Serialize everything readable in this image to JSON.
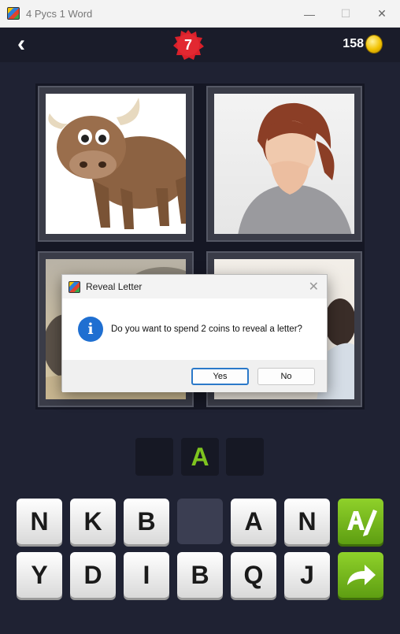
{
  "window": {
    "title": "4 Pycs 1 Word",
    "minimize_glyph": "—",
    "maximize_glyph": "☐",
    "close_glyph": "✕"
  },
  "header": {
    "back_glyph": "‹",
    "level": "7",
    "coins": "158"
  },
  "images": [
    {
      "icon": "yak-icon"
    },
    {
      "icon": "woman-coughing-icon"
    },
    {
      "icon": "animal-photo-icon"
    },
    {
      "icon": "person-photo-icon"
    }
  ],
  "answer": {
    "slots": [
      "",
      "A",
      ""
    ]
  },
  "keyboard": {
    "row1": [
      "N",
      "K",
      "B",
      "",
      "A",
      "N"
    ],
    "row2": [
      "Y",
      "D",
      "I",
      "B",
      "Q",
      "J"
    ]
  },
  "dialog": {
    "title": "Reveal Letter",
    "close_glyph": "✕",
    "info_glyph": "i",
    "message": "Do you want to spend 2 coins to reveal a letter?",
    "yes_label": "Yes",
    "no_label": "No"
  },
  "colors": {
    "background": "#1f2233",
    "letter_green": "#7ec41f",
    "badge_red": "#d9202a",
    "dialog_accent": "#2b79c9"
  }
}
